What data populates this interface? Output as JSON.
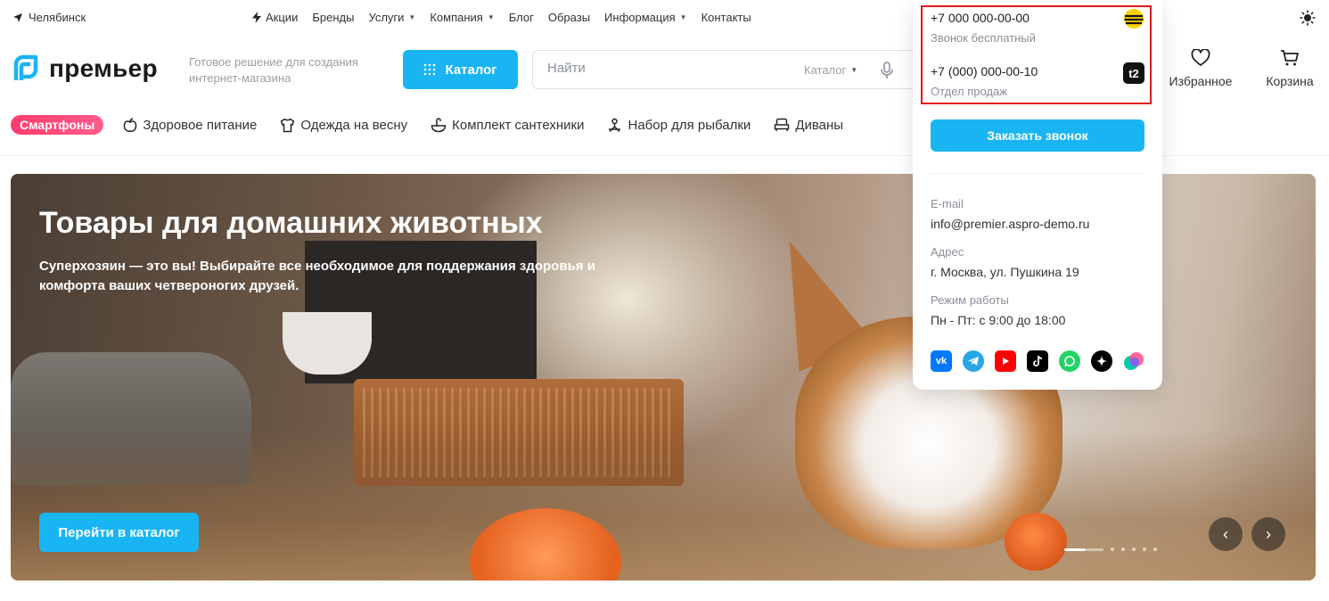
{
  "topbar": {
    "city": "Челябинск",
    "nav": [
      {
        "label": "Акции",
        "icon": "lightning-icon"
      },
      {
        "label": "Бренды"
      },
      {
        "label": "Услуги",
        "dropdown": true
      },
      {
        "label": "Компания",
        "dropdown": true
      },
      {
        "label": "Блог"
      },
      {
        "label": "Образы"
      },
      {
        "label": "Информация",
        "dropdown": true
      },
      {
        "label": "Контакты"
      }
    ]
  },
  "header": {
    "logo_text": "премьер",
    "slogan": "Готовое решение для создания интернет-магазина",
    "catalog_label": "Каталог",
    "search": {
      "placeholder": "Найти",
      "scope": "Каталог"
    },
    "favorites_label": "Избранное",
    "cart_label": "Корзина"
  },
  "categories": [
    {
      "label": "Смартфоны",
      "badge": true
    },
    {
      "label": "Здоровое питание",
      "icon": "apple-icon"
    },
    {
      "label": "Одежда на весну",
      "icon": "shirt-icon"
    },
    {
      "label": "Комплект сантехники",
      "icon": "sink-icon"
    },
    {
      "label": "Набор для рыбалки",
      "icon": "fishing-icon"
    },
    {
      "label": "Диваны",
      "icon": "sofa-icon"
    }
  ],
  "banner": {
    "title": "Товары для домашних животных",
    "text": "Суперхозяин — это вы! Выбирайте все необходимое для поддержания здоровья и комфорта ваших четвероногих друзей.",
    "button_label": "Перейти в каталог",
    "slides_total": 8,
    "slide_active": 1,
    "prev_arrow": "‹",
    "next_arrow": "›"
  },
  "contacts_popup": {
    "phones": [
      {
        "number": "+7 000 000-00-00",
        "note": "Звонок бесплатный",
        "operator_icon": "beeline-icon"
      },
      {
        "number": "+7 (000) 000-00-10",
        "note": "Отдел продаж",
        "operator_icon": "t2-icon",
        "operator_label": "t2"
      }
    ],
    "call_button": "Заказать звонок",
    "email_label": "E-mail",
    "email": "info@premier.aspro-demo.ru",
    "address_label": "Адрес",
    "address": "г. Москва, ул. Пушкина 19",
    "hours_label": "Режим работы",
    "hours": "Пн - Пт: с 9:00 до 18:00",
    "socials": [
      {
        "name": "vk-icon",
        "glyph": "vk",
        "color": "#0077ff"
      },
      {
        "name": "telegram-icon",
        "color": "#27a7e7"
      },
      {
        "name": "youtube-icon",
        "color": "#ff0000"
      },
      {
        "name": "tiktok-icon",
        "color": "#000000"
      },
      {
        "name": "whatsapp-icon",
        "color": "#25d366"
      },
      {
        "name": "zen-icon",
        "color": "#000000"
      },
      {
        "name": "odnoklassniki-icon",
        "color": "#7b61ff"
      }
    ]
  },
  "colors": {
    "accent": "#19b5f3",
    "badge": "#ff3d6e",
    "highlight_border": "#e01818"
  }
}
